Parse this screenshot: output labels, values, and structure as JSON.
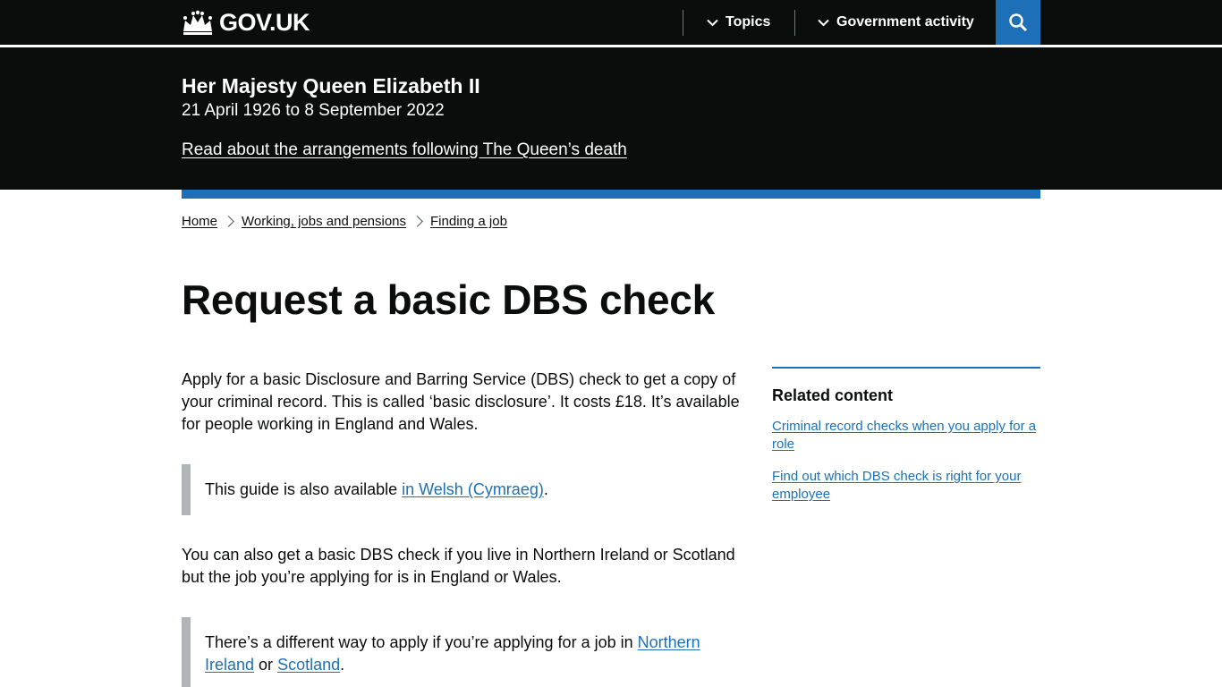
{
  "header": {
    "logo_text": "GOV.UK",
    "nav": [
      {
        "label": "Topics"
      },
      {
        "label": "Government activity"
      }
    ],
    "search_icon": "search-icon",
    "colors": {
      "background": "#0b0c0c",
      "search": "#1d70b8"
    }
  },
  "banner": {
    "title": "Her Majesty Queen Elizabeth II",
    "dates": "21 April 1926 to 8 September 2022",
    "link": "Read about the arrangements following The Queen’s death"
  },
  "breadcrumb": [
    {
      "label": "Home"
    },
    {
      "label": "Working, jobs and pensions"
    },
    {
      "label": "Finding a job"
    }
  ],
  "main": {
    "title": "Request a basic DBS check",
    "para1": "Apply for a basic Disclosure and Barring Service (DBS) check to get a copy of your criminal record. This is called ‘basic disclosure’. It costs £18. It’s available for people working in England and Wales.",
    "inset1": {
      "before": "This guide is also available ",
      "link": "in Welsh (Cymraeg)",
      "after": "."
    },
    "para2": "You can also get a basic DBS check if you live in Northern Ireland or Scotland but the job you’re applying for is in England or Wales.",
    "inset2": {
      "before": "There’s a different way to apply if you’re applying for a job in ",
      "link1": "Northern Ireland",
      "middle": " or ",
      "link2": "Scotland",
      "after": "."
    }
  },
  "related": {
    "heading": "Related content",
    "links": [
      {
        "label": "Criminal record checks when you apply for a role"
      },
      {
        "label": "Find out which DBS check is right for your employee"
      }
    ]
  }
}
